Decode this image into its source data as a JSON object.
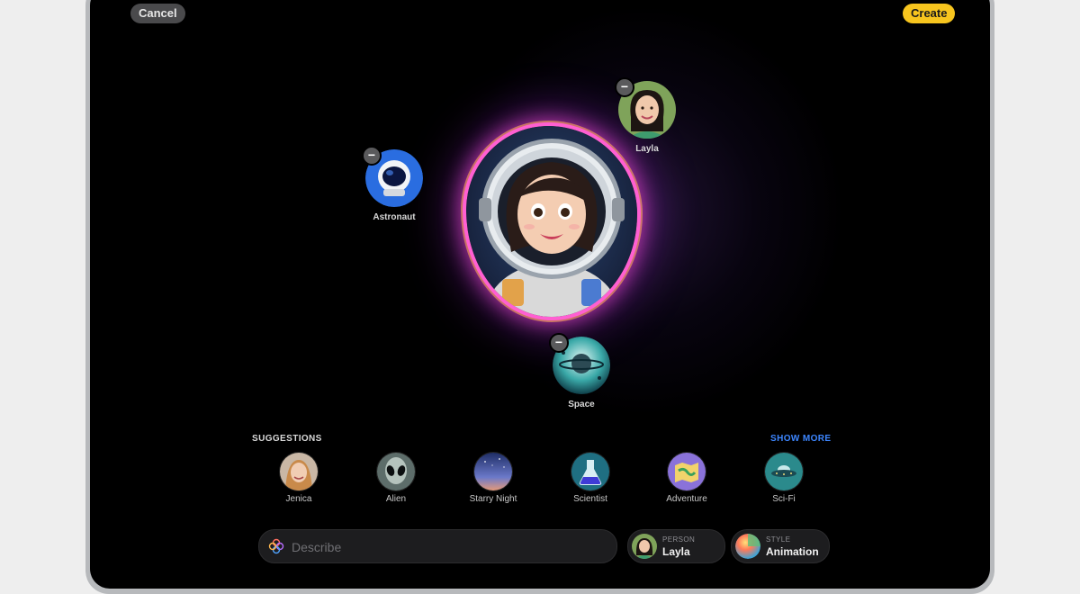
{
  "toolbar": {
    "cancel_label": "Cancel",
    "create_label": "Create"
  },
  "concepts": [
    {
      "label": "Astronaut"
    },
    {
      "label": "Layla"
    },
    {
      "label": "Space"
    }
  ],
  "suggestions": {
    "title": "SUGGESTIONS",
    "show_more": "SHOW MORE",
    "items": [
      {
        "label": "Jenica"
      },
      {
        "label": "Alien"
      },
      {
        "label": "Starry Night"
      },
      {
        "label": "Scientist"
      },
      {
        "label": "Adventure"
      },
      {
        "label": "Sci-Fi"
      }
    ]
  },
  "describe": {
    "placeholder": "Describe"
  },
  "person_chip": {
    "kind": "PERSON",
    "value": "Layla"
  },
  "style_chip": {
    "kind": "STYLE",
    "value": "Animation"
  },
  "colors": {
    "accent": "#f7c51e",
    "link": "#3d86ff",
    "glow": "#ff5fd2"
  }
}
